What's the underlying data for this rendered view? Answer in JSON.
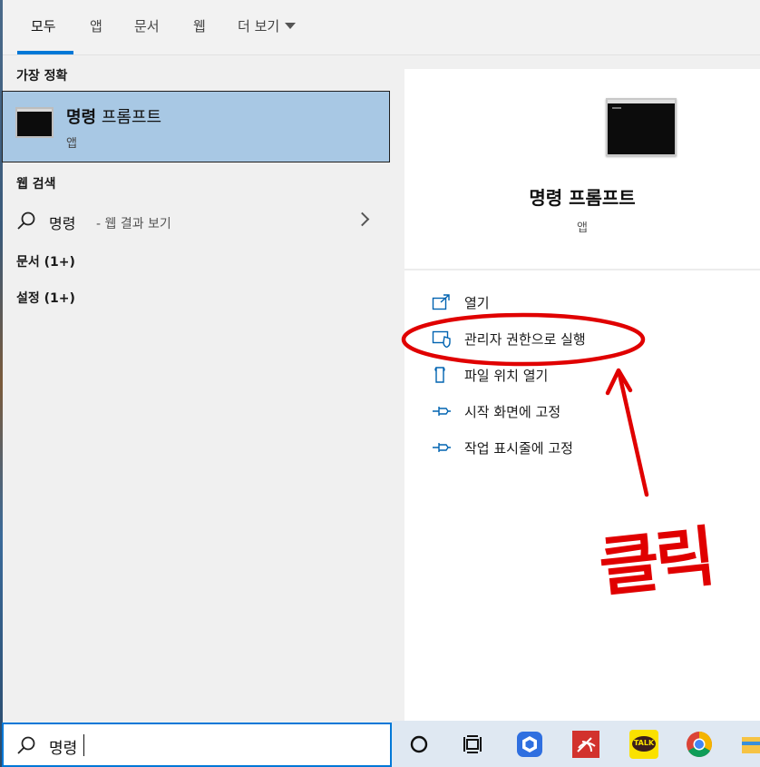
{
  "tabs": [
    {
      "label": "모두",
      "active": true
    },
    {
      "label": "앱"
    },
    {
      "label": "문서"
    },
    {
      "label": "웹"
    },
    {
      "label": "더 보기"
    }
  ],
  "results": {
    "best_match_header": "가장 정확",
    "best_match": {
      "title_bold": "명령",
      "title_rest": " 프롬프트",
      "subtitle": "앱",
      "icon": "command-prompt-icon"
    },
    "web_header": "웹 검색",
    "web_query": "명령",
    "web_suffix": " - 웹 결과 보기",
    "docs_header": "문서 (1+)",
    "settings_header": "설정 (1+)"
  },
  "preview": {
    "title": "명령 프롬프트",
    "subtitle": "앱",
    "actions": [
      {
        "label": "열기",
        "icon": "open-icon"
      },
      {
        "label": "관리자 권한으로 실행",
        "icon": "shield-icon"
      },
      {
        "label": "파일 위치 열기",
        "icon": "file-location-icon"
      },
      {
        "label": "시작 화면에 고정",
        "icon": "pin-icon"
      },
      {
        "label": "작업 표시줄에 고정",
        "icon": "pin-icon"
      }
    ]
  },
  "annotation": {
    "text": "클릭",
    "color": "#e00000"
  },
  "search": {
    "value": "명령"
  },
  "taskbar": {
    "items": [
      "cortana-icon",
      "task-view-icon",
      "app-icon-blue",
      "app-icon-red",
      "kakaotalk-icon",
      "chrome-icon",
      "file-explorer-icon"
    ],
    "kakao_label": "TALK"
  },
  "colors": {
    "accent": "#0078d7",
    "selection": "#a8c8e4",
    "annotation": "#e00000"
  }
}
